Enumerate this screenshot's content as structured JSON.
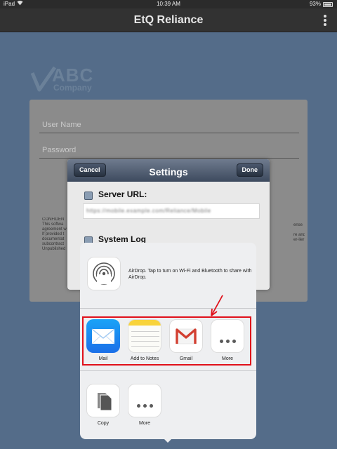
{
  "status_bar": {
    "device": "iPad",
    "time": "10:39 AM",
    "battery": "93%",
    "battery_level": 0.93
  },
  "app": {
    "title": "EtQ Reliance"
  },
  "logo": {
    "abc": "ABC",
    "company": "Company"
  },
  "login": {
    "username_placeholder": "User Name",
    "password_placeholder": "Password",
    "confidential_left": [
      "CONFIDEN",
      "This softwa",
      "agreement w",
      "If provided t",
      "documentat",
      "subcontract",
      "Unpublished"
    ],
    "confidential_right": [
      "ense",
      "",
      "re and",
      "er-lier"
    ]
  },
  "settings_modal": {
    "title": "Settings",
    "cancel_label": "Cancel",
    "done_label": "Done",
    "server_url_label": "Server URL:",
    "server_url_value": "https://mobile.example.com/Reliance/Mobile",
    "system_log_label": "System Log"
  },
  "share_sheet": {
    "airdrop_text": "AirDrop. Tap to turn on Wi-Fi and Bluetooth to share with AirDrop.",
    "apps": [
      {
        "label": "Mail",
        "icon": "mail-icon"
      },
      {
        "label": "Add to Notes",
        "icon": "notes-icon"
      },
      {
        "label": "Gmail",
        "icon": "gmail-icon"
      },
      {
        "label": "More",
        "icon": "more-icon"
      }
    ],
    "actions": [
      {
        "label": "Copy",
        "icon": "copy-icon"
      },
      {
        "label": "More",
        "icon": "more-icon"
      }
    ]
  },
  "colors": {
    "highlight": "#e0101a",
    "nav_bar": "#323232",
    "backdrop": "#546c89"
  }
}
